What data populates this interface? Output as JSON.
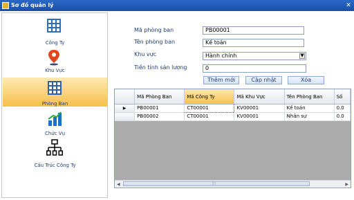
{
  "window": {
    "title": "Sơ đồ quản lý",
    "close_glyph": "✕"
  },
  "sidebar": {
    "items": [
      {
        "label": "Công Ty",
        "icon": "building-grid-icon",
        "active": false
      },
      {
        "label": "Khu Vực",
        "icon": "location-pin-icon",
        "active": false
      },
      {
        "label": "Phòng Ban",
        "icon": "building-grid-icon",
        "active": true
      },
      {
        "label": "Chức Vụ",
        "icon": "bar-chart-icon",
        "active": false
      },
      {
        "label": "Cấu Trúc Công Ty",
        "icon": "org-chart-icon",
        "active": false
      }
    ]
  },
  "form": {
    "ma_label": "Mã phòng ban",
    "ma_value": "PB00001",
    "ten_label": "Tên phòng ban",
    "ten_value": "Kế toán",
    "khuvuc_label": "Khu vực",
    "khuvuc_value": "Hành chính",
    "tien_label": "Tiền tính sản lượng",
    "tien_value": "0",
    "btn_add": "Thêm mới",
    "btn_update": "Cập nhật",
    "btn_delete": "Xóa"
  },
  "grid": {
    "columns": [
      "Mã Phòng Ban",
      "Mã Công Ty",
      "Mã Khu Vực",
      "Tên Phòng Ban",
      "Số"
    ],
    "rows": [
      [
        "PB00001",
        "CT00001",
        "KV00001",
        "Kế toán",
        "0.0"
      ],
      [
        "PB00002",
        "CT00001",
        "KV00001",
        "Nhân sự",
        "0.0"
      ]
    ],
    "current_row_marker": "▶",
    "scroll_left": "◀",
    "scroll_right": "▶",
    "scroll_grip": "|||"
  },
  "colors": {
    "titlebar": "#1a4fa6",
    "accent": "#f7c04c",
    "label": "#1f3d7a"
  }
}
